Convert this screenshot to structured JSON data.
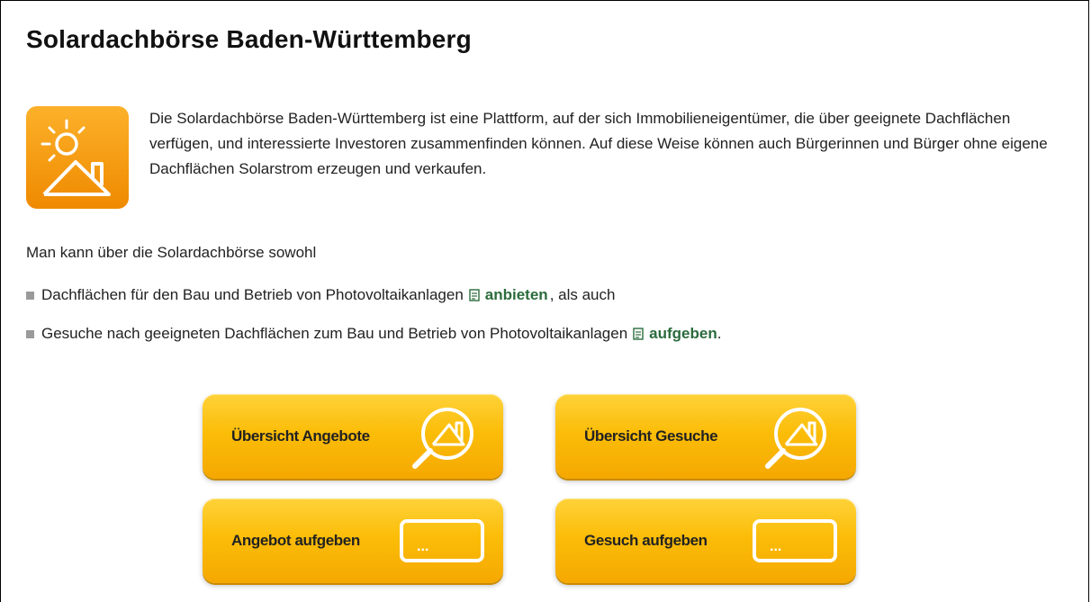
{
  "page": {
    "title": "Solardachbörse Baden-Württemberg",
    "intro": "Die Solardachbörse Baden-Württemberg ist eine Plattform, auf der sich Immobilieneigentümer, die über geeignete Dachflächen verfügen, und interessierte Investoren zusammenfinden können. Auf diese Weise können auch Bürgerinnen und Bürger ohne eigene Dachflächen Solarstrom erzeugen und verkaufen.",
    "lead": "Man kann über die Solardachbörse sowohl"
  },
  "bullets": [
    {
      "text": "Dachflächen für den Bau und Betrieb von Photovoltaikanlagen",
      "link": "anbieten",
      "tail": ", als auch"
    },
    {
      "text": "Gesuche nach geeigneten Dachflächen zum Bau und Betrieb von Photovoltaikanlagen",
      "link": "aufgeben",
      "tail": "."
    }
  ],
  "buttons": {
    "overview_offers": "Übersicht Angebote",
    "overview_requests": "Übersicht Gesuche",
    "post_offer": "Angebot aufgeben",
    "post_request": "Gesuch aufgeben",
    "field_dots": "..."
  },
  "colors": {
    "accent": "#fbbd08",
    "link": "#2b6b3c",
    "icon_orange": "#f39200"
  },
  "icons": {
    "hero": "sun-house-icon",
    "bullet_link": "document-icon",
    "overview": "magnifier-house-icon",
    "post": "input-field-icon"
  }
}
